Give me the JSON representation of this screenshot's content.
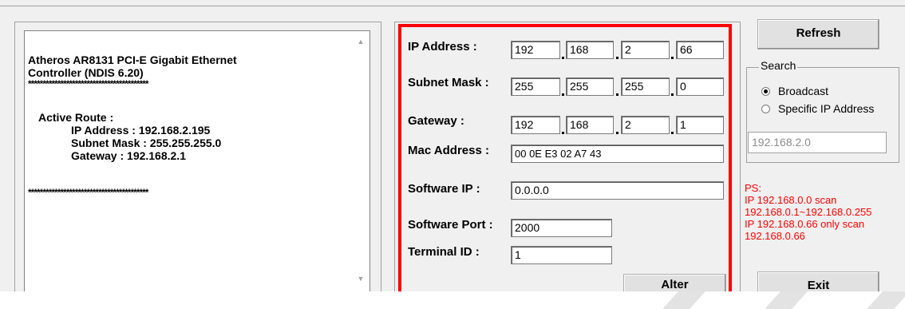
{
  "info_panel": {
    "adapter_line1": "Atheros AR8131 PCI-E Gigabit Ethernet",
    "adapter_line2": "Controller (NDIS 6.20)",
    "separator": "*****************************************",
    "active_route_label": "Active Route :",
    "ip_line": "IP Address : 192.168.2.195",
    "mask_line": "Subnet Mask : 255.255.255.0",
    "gateway_line": "Gateway : 192.168.2.1"
  },
  "config": {
    "ip_label": "IP Address :",
    "ip": [
      "192",
      "168",
      "2",
      "66"
    ],
    "mask_label": "Subnet Mask :",
    "mask": [
      "255",
      "255",
      "255",
      "0"
    ],
    "gateway_label": "Gateway :",
    "gateway": [
      "192",
      "168",
      "2",
      "1"
    ],
    "mac_label": "Mac Address :",
    "mac": "00 0E E3 02 A7 43",
    "software_ip_label": "Software IP :",
    "software_ip": "0.0.0.0",
    "software_port_label": "Software Port :",
    "software_port": "2000",
    "terminal_id_label": "Terminal ID :",
    "terminal_id": "1",
    "alter_label": "Alter"
  },
  "right": {
    "refresh_label": "Refresh",
    "search_title": "Search",
    "broadcast_label": "Broadcast",
    "specific_label": "Specific IP Address",
    "selected": "Broadcast",
    "search_ip": "192.168.2.0",
    "ps_lines": [
      "PS:",
      "IP 192.168.0.0 scan",
      "192.168.0.1~192.168.0.255",
      "IP 192.168.0.66 only scan",
      "192.168.0.66"
    ],
    "exit_label": "Exit"
  },
  "colors": {
    "highlight": "#ff0000",
    "note_text": "#ff0000"
  }
}
